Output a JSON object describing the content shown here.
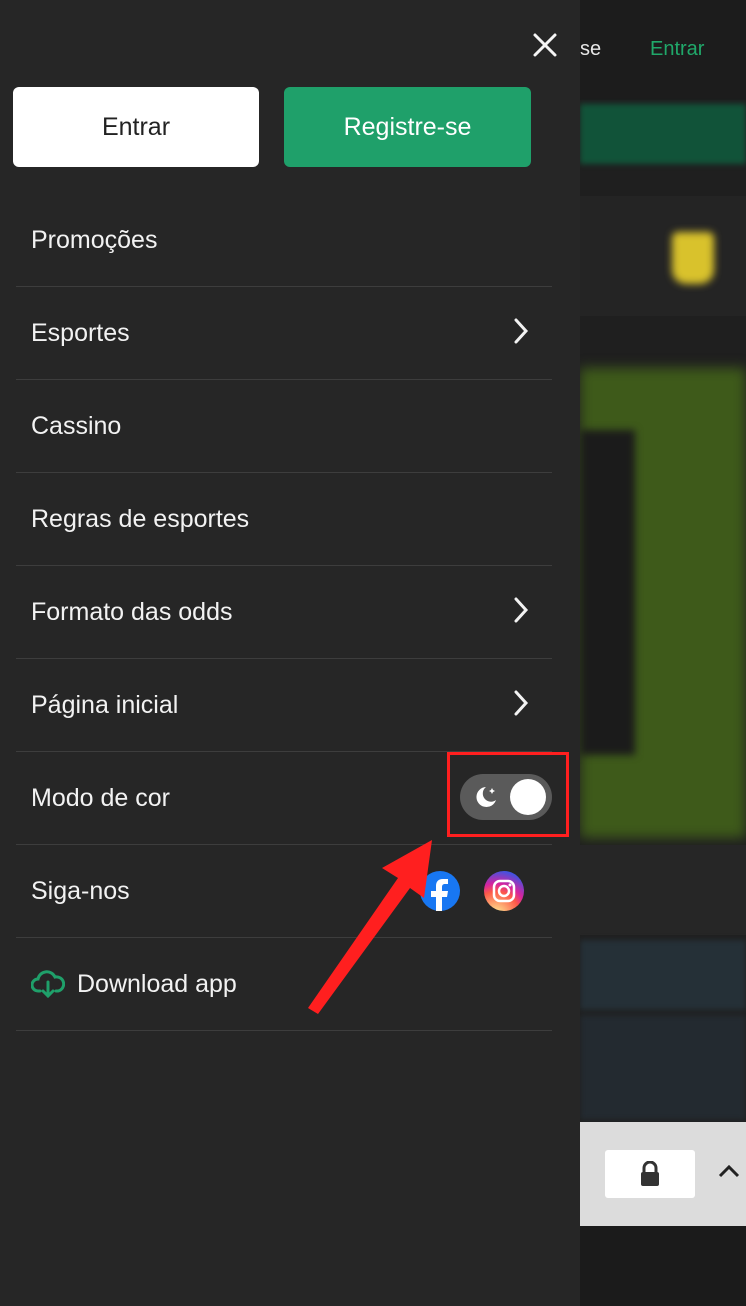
{
  "background": {
    "header_partial": "se",
    "header_login": "Entrar"
  },
  "drawer": {
    "login_button": "Entrar",
    "register_button": "Registre-se",
    "items": [
      {
        "label": "Promoções"
      },
      {
        "label": "Esportes"
      },
      {
        "label": "Cassino"
      },
      {
        "label": "Regras de esportes"
      },
      {
        "label": "Formato das odds"
      },
      {
        "label": "Página inicial"
      },
      {
        "label": "Modo de cor"
      },
      {
        "label": "Siga-nos"
      },
      {
        "label": "Download app"
      }
    ]
  },
  "colors": {
    "brand_green": "#1fa06a",
    "drawer_bg": "#262626",
    "annotation_red": "#ff1f1f"
  },
  "icons": [
    "close-icon",
    "chevron-right-icon",
    "moon-icon",
    "facebook-icon",
    "instagram-icon",
    "cloud-download-icon",
    "lock-icon",
    "chevron-up-icon"
  ]
}
